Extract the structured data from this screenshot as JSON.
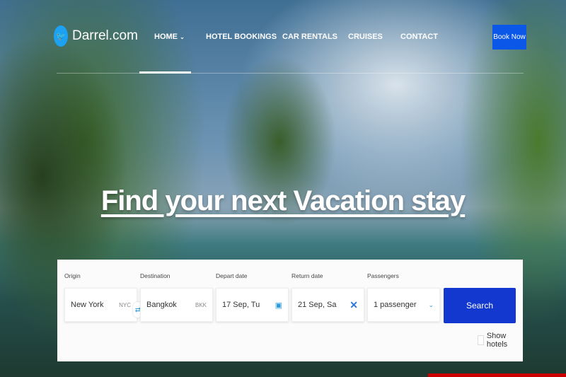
{
  "brand": {
    "name": "Darrel.com",
    "icon": "twitter-bird-icon",
    "color": "#1da1f2"
  },
  "nav": {
    "items": [
      {
        "label": "HOME",
        "has_dropdown": true,
        "active": true
      },
      {
        "label": "HOTEL BOOKINGS"
      },
      {
        "label": "CAR RENTALS"
      },
      {
        "label": "CRUISES"
      },
      {
        "label": "CONTACT"
      }
    ],
    "cta": "Book Now"
  },
  "hero": {
    "title": "Find your next Vacation stay"
  },
  "form": {
    "origin": {
      "label": "Origin",
      "value": "New York",
      "code": "NYC"
    },
    "destination": {
      "label": "Destination",
      "value": "Bangkok",
      "code": "BKK"
    },
    "depart": {
      "label": "Depart date",
      "value": "17 Sep, Tu"
    },
    "return": {
      "label": "Return date",
      "value": "21 Sep, Sa"
    },
    "passengers": {
      "label": "Passengers",
      "value": "1 passenger"
    },
    "search": "Search",
    "show_hotels": {
      "label": "Show hotels",
      "checked": false
    }
  },
  "colors": {
    "accent": "#1238d0",
    "cta": "#0a57e8"
  }
}
